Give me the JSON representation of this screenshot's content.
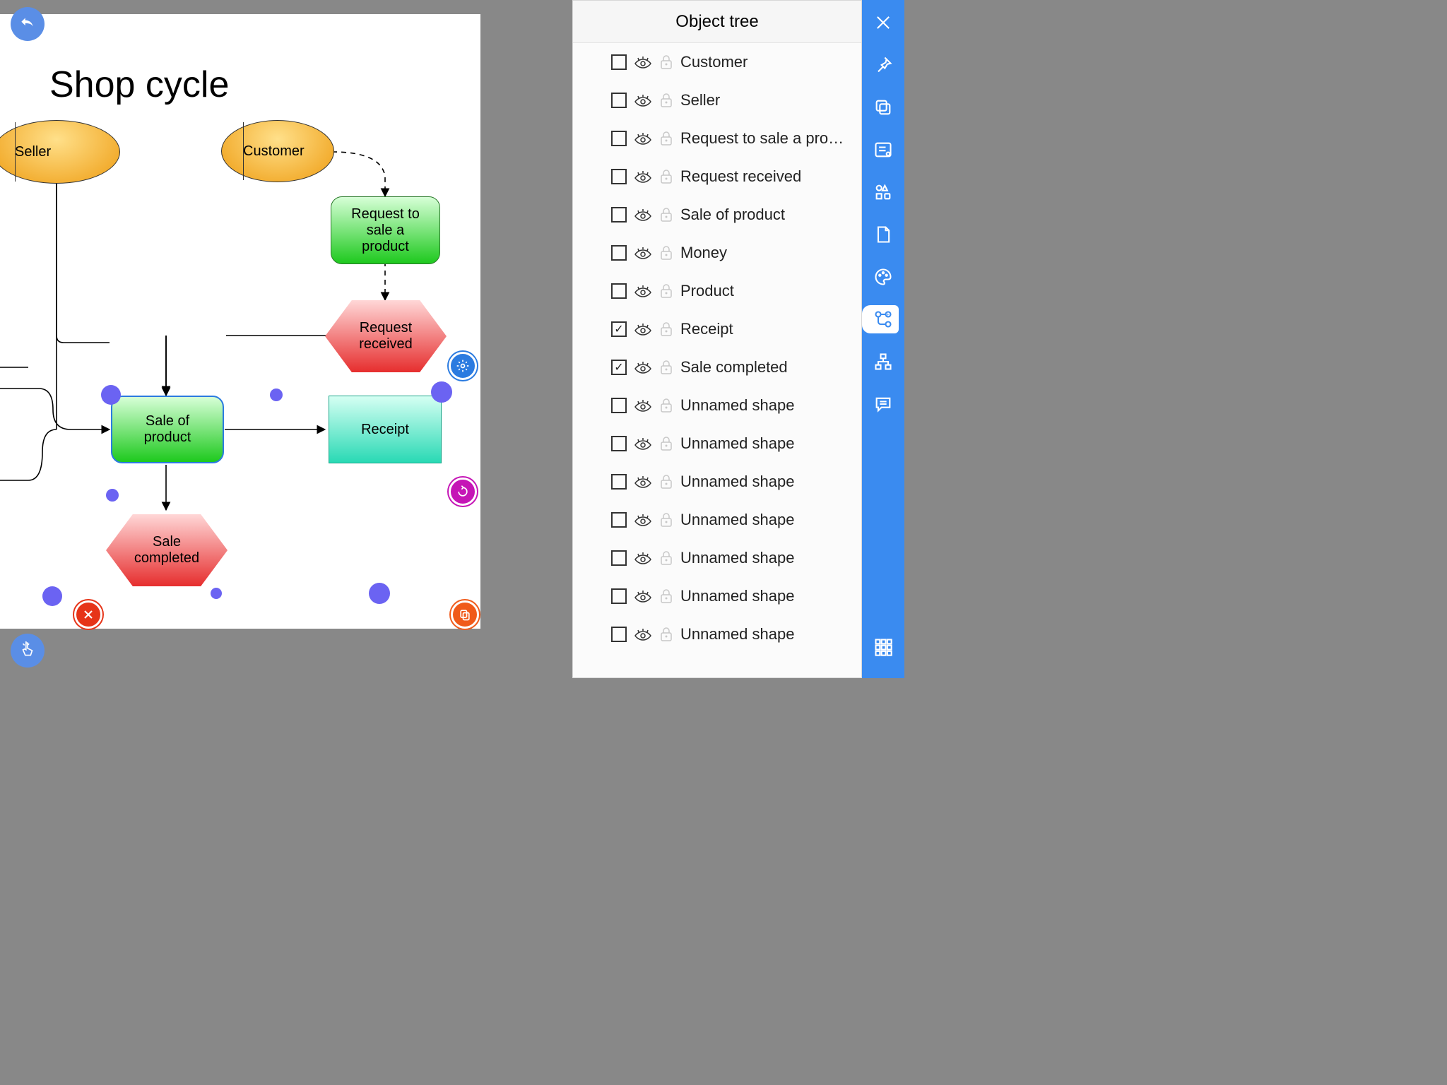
{
  "diagram_title": "Shop cycle",
  "shapes": {
    "seller": "Seller",
    "customer": "Customer",
    "request_sale": "Request to\nsale a\nproduct",
    "request_received": "Request\nreceived",
    "sale_of_product": "Sale of\nproduct",
    "receipt": "Receipt",
    "sale_completed": "Sale\ncompleted"
  },
  "panel": {
    "title": "Object tree",
    "items": [
      {
        "label": "Customer",
        "checked": false
      },
      {
        "label": "Seller",
        "checked": false
      },
      {
        "label": "Request to sale a pro…",
        "checked": false
      },
      {
        "label": "Request received",
        "checked": false
      },
      {
        "label": "Sale of product",
        "checked": false
      },
      {
        "label": "Money",
        "checked": false
      },
      {
        "label": "Product",
        "checked": false
      },
      {
        "label": "Receipt",
        "checked": true
      },
      {
        "label": "Sale completed",
        "checked": true
      },
      {
        "label": "Unnamed shape",
        "checked": false
      },
      {
        "label": "Unnamed shape",
        "checked": false
      },
      {
        "label": "Unnamed shape",
        "checked": false
      },
      {
        "label": "Unnamed shape",
        "checked": false
      },
      {
        "label": "Unnamed shape",
        "checked": false
      },
      {
        "label": "Unnamed shape",
        "checked": false
      },
      {
        "label": "Unnamed shape",
        "checked": false
      }
    ]
  },
  "toolbar": {
    "items": [
      "close",
      "pin",
      "layers",
      "settings-list",
      "shapes",
      "page",
      "palette",
      "tree",
      "sitemap",
      "comment"
    ],
    "bottom": "grid",
    "active": "tree"
  }
}
